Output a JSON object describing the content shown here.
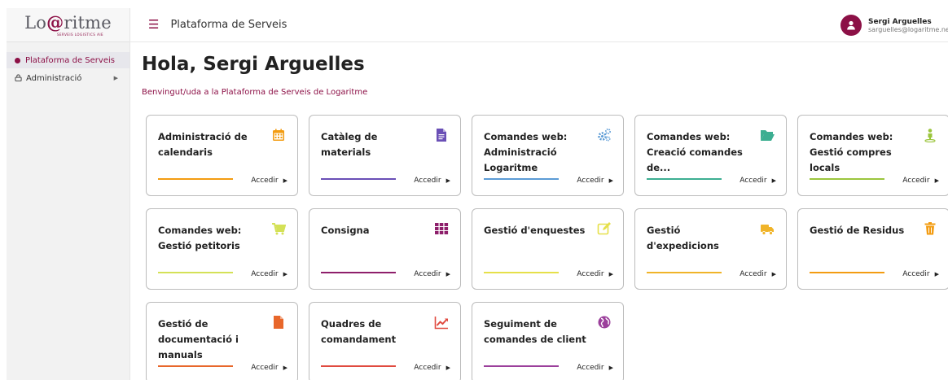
{
  "sidebar": {
    "logo_text": "Lo@ritme",
    "logo_subtitle": "SERVEIS LOGISTICS AIE",
    "items": [
      {
        "label": "Plataforma de Serveis"
      },
      {
        "label": "Administració"
      }
    ]
  },
  "header": {
    "title": "Plataforma de Serveis",
    "user_name": "Sergi Arguelles",
    "user_email": "sarguelles@logaritme.net"
  },
  "main": {
    "greeting": "Hola, Sergi Arguelles",
    "welcome": "Benvingut/uda a la Plataforma de Serveis de Logaritme",
    "cards": [
      {
        "title": "Administració de calendaris",
        "icon": "calendar-icon",
        "color": "#f39c12",
        "link": "Accedir"
      },
      {
        "title": "Catàleg de materials",
        "icon": "document-icon",
        "color": "#6a4fb6",
        "link": "Accedir"
      },
      {
        "title": "Comandes web: Administració Logaritme",
        "icon": "gears-icon",
        "color": "#5b9bd5",
        "link": "Accedir"
      },
      {
        "title": "Comandes web: Creació comandes de...",
        "icon": "folder-open-icon",
        "color": "#3cae91",
        "link": "Accedir"
      },
      {
        "title": "Comandes web: Gestió compres locals",
        "icon": "person-pin-icon",
        "color": "#9bc53d",
        "link": "Accedir"
      },
      {
        "title": "Comandes web: Gestió petitoris",
        "icon": "cart-icon",
        "color": "#d4e157",
        "link": "Accedir"
      },
      {
        "title": "Consigna",
        "icon": "grid-icon",
        "color": "#8e1f6b",
        "link": "Accedir"
      },
      {
        "title": "Gestió d'enquestes",
        "icon": "edit-icon",
        "color": "#e6e04a",
        "link": "Accedir"
      },
      {
        "title": "Gestió d'expedicions",
        "icon": "truck-icon",
        "color": "#f0b429",
        "link": "Accedir"
      },
      {
        "title": "Gestió de Residus",
        "icon": "trash-icon",
        "color": "#f39c12",
        "link": "Accedir"
      },
      {
        "title": "Gestió de documentació i manuals",
        "icon": "file-icon",
        "color": "#e8672b",
        "link": "Accedir"
      },
      {
        "title": "Quadres de comandament",
        "icon": "chart-line-icon",
        "color": "#e04a3f",
        "link": "Accedir"
      },
      {
        "title": "Seguiment de comandes de client",
        "icon": "globe-icon",
        "color": "#9b3f9b",
        "link": "Accedir"
      }
    ]
  }
}
